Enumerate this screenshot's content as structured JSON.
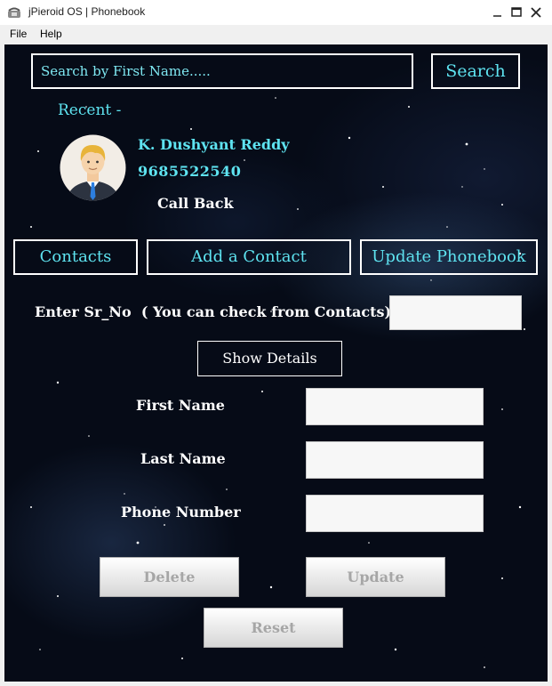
{
  "window": {
    "title": "jPieroid OS | Phonebook",
    "minimize_icon": "minimize-icon",
    "maximize_icon": "maximize-icon",
    "close_icon": "close-icon"
  },
  "menu": {
    "items": [
      "File",
      "Help"
    ]
  },
  "search": {
    "placeholder": "Search by First Name.....",
    "button_label": "Search"
  },
  "recent": {
    "label": "Recent -",
    "name": "K. Dushyant Reddy",
    "phone": "9685522540",
    "call_back_label": "Call Back",
    "avatar_icon": "user-avatar-icon"
  },
  "tabs": [
    "Contacts",
    "Add a Contact",
    "Update Phonebook"
  ],
  "form": {
    "sr_no_label": "Enter Sr_No  ( You can check from Contacts)",
    "show_details_label": "Show Details",
    "first_name_label": "First Name",
    "last_name_label": "Last Name",
    "phone_number_label": "Phone Number"
  },
  "actions": {
    "delete_label": "Delete",
    "update_label": "Update",
    "reset_label": "Reset"
  },
  "colors": {
    "accent": "#5ee3f0",
    "background": "#060b17",
    "text": "#ffffff",
    "disabled_text": "#a6a6a6"
  }
}
